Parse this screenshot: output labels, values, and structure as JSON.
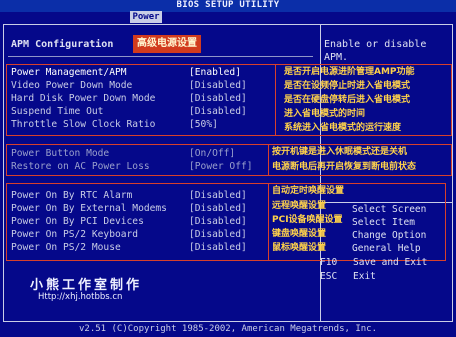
{
  "header": {
    "title": "BIOS SETUP UTILITY",
    "tab": "Power"
  },
  "section": {
    "title": "APM Configuration",
    "annotation": "高级电源设置"
  },
  "help": {
    "description_lines": [
      "Enable or disable",
      "APM."
    ]
  },
  "settings": {
    "group1": [
      {
        "label": "Power Management/APM",
        "value": "[Enabled]",
        "note": "是否开启电源进阶管理AMP功能"
      },
      {
        "label": "Video Power Down Mode",
        "value": "[Disabled]",
        "note": "是否在设频停止时进入省电模式"
      },
      {
        "label": "Hard Disk Power Down Mode",
        "value": "[Disabled]",
        "note": "是否在硬盘停转后进入省电模式"
      },
      {
        "label": "Suspend Time Out",
        "value": "[Disabled]",
        "note": "进入省电模式的时间"
      },
      {
        "label": "Throttle Slow Clock Ratio",
        "value": "[50%]",
        "note": "系统进入省电模式的运行速度"
      }
    ],
    "group2": [
      {
        "label": "Power Button Mode",
        "value": "[On/Off]",
        "note": "按开机键是进入休眠模式还是关机"
      },
      {
        "label": "Restore on AC Power Loss",
        "value": "[Power Off]",
        "note": "电源断电后再开启恢复到断电前状态"
      }
    ],
    "group3": [
      {
        "label": "Power On By RTC Alarm",
        "value": "[Disabled]",
        "note": "自动定时唤醒设置"
      },
      {
        "label": "Power On By External Modems",
        "value": "[Disabled]",
        "note": "远程唤醒设置"
      },
      {
        "label": "Power On By PCI Devices",
        "value": "[Disabled]",
        "note": "PCI设备唤醒设置"
      },
      {
        "label": "Power On PS/2 Keyboard",
        "value": "[Disabled]",
        "note": "键盘唤醒设置"
      },
      {
        "label": "Power On PS/2 Mouse",
        "value": "[Disabled]",
        "note": "鼠标唤醒设置"
      }
    ]
  },
  "keys": [
    {
      "key": "",
      "desc": "Select Screen"
    },
    {
      "key": "",
      "desc": "Select Item"
    },
    {
      "key": "",
      "desc": "Change Option"
    },
    {
      "key": "",
      "desc": "General Help"
    },
    {
      "key": "F10",
      "desc": "Save and Exit"
    },
    {
      "key": "ESC",
      "desc": "Exit"
    }
  ],
  "watermark": {
    "text": "小熊工作室制作",
    "url": "Http://xhj.hotbbs.cn"
  },
  "footer": {
    "text": "v2.51 (C)Copyright 1985-2002, American Megatrends, Inc."
  },
  "colors": {
    "background": "#05088a",
    "annotation_red": "#d23b1e",
    "annotation_yellow": "#ffd24a",
    "text": "#c9cde6"
  }
}
